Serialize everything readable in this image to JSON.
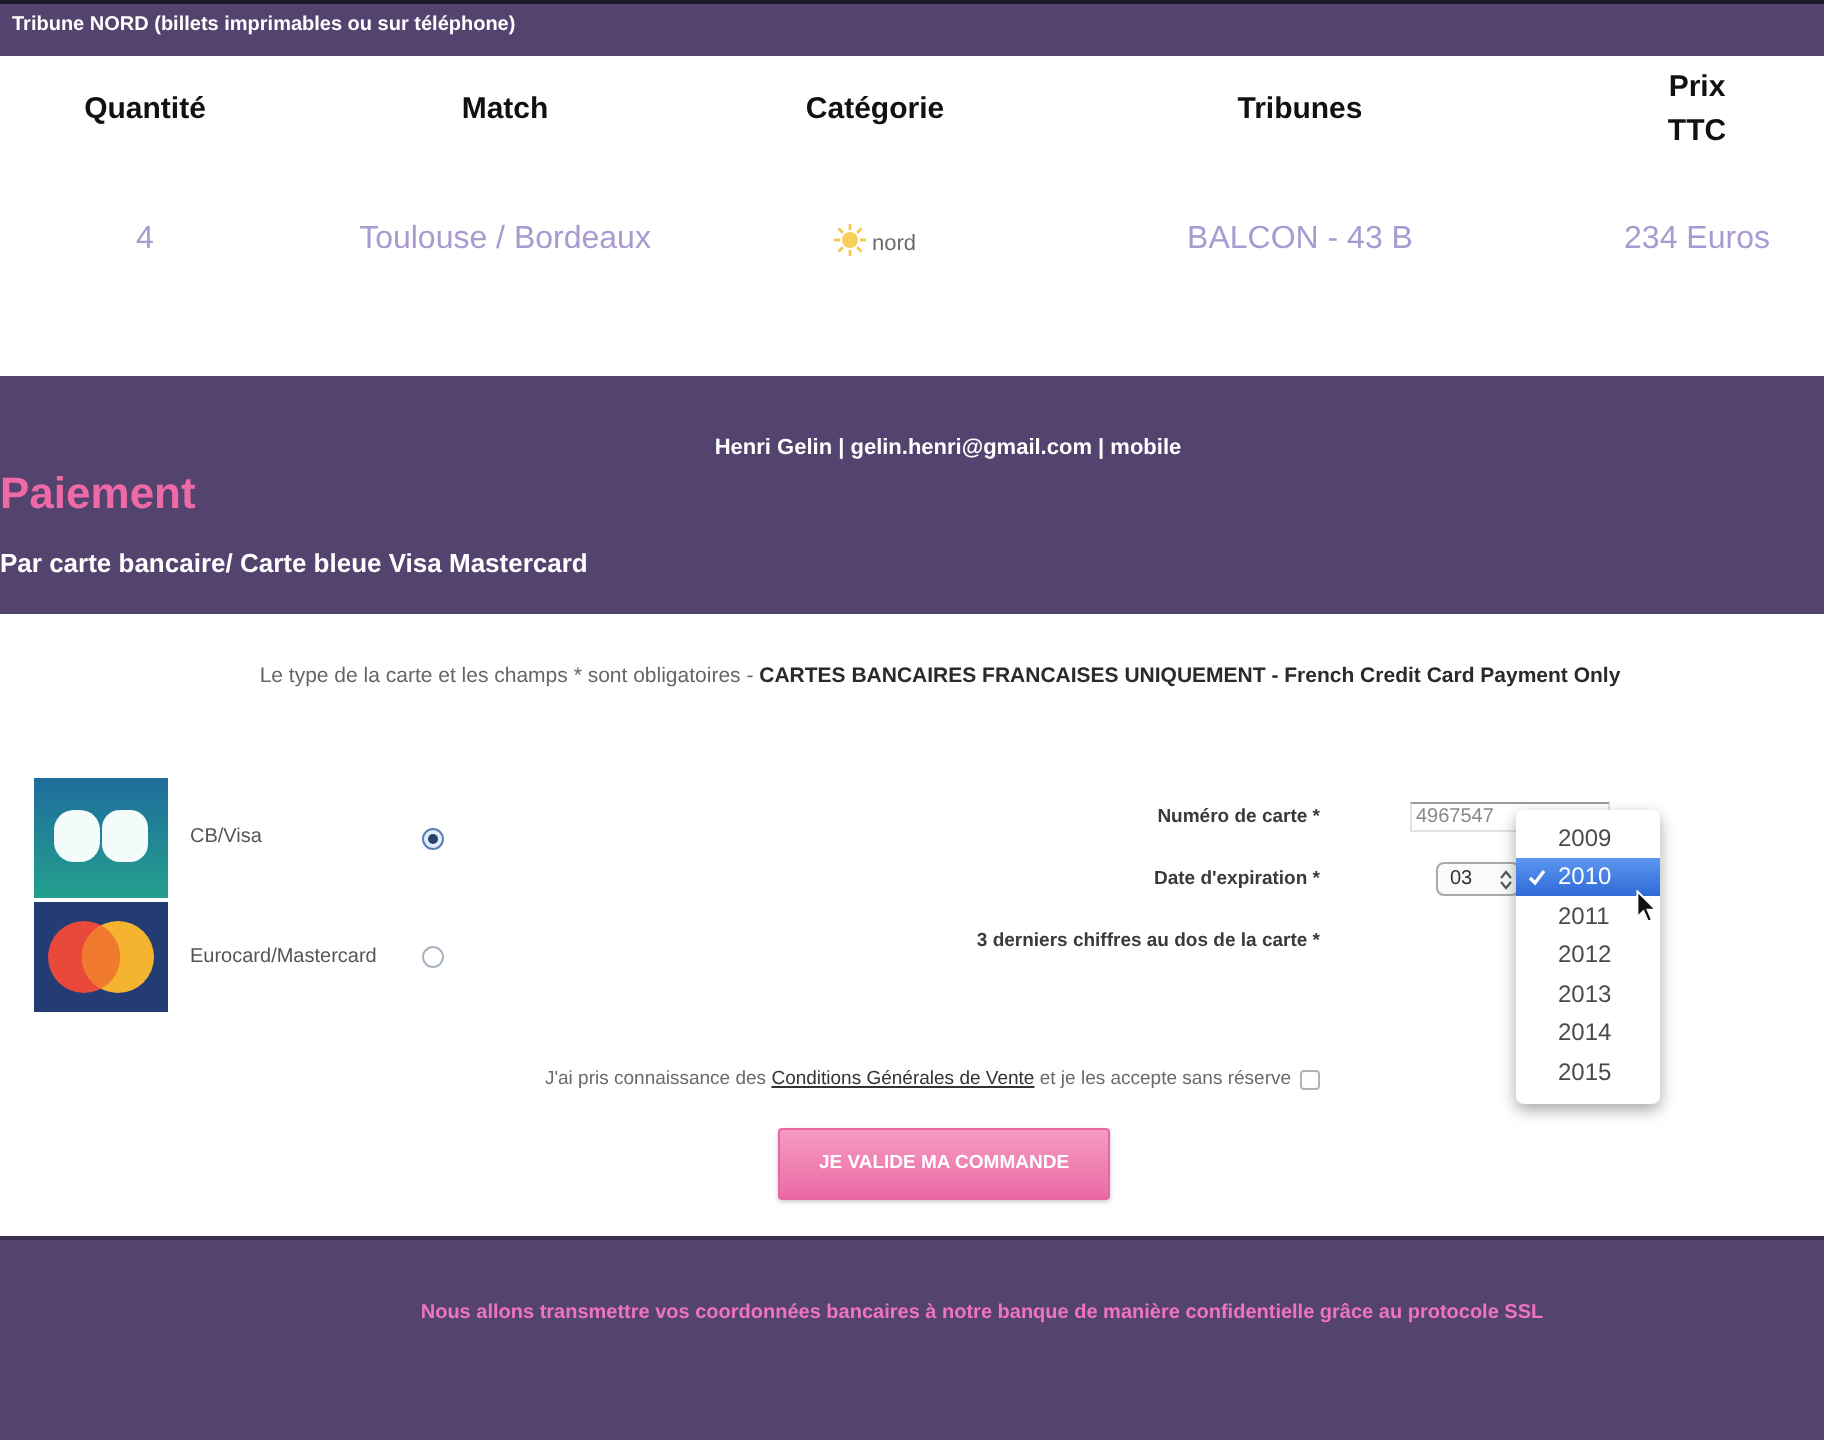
{
  "top_banner": {
    "text": "Tribune NORD (billets imprimables ou sur téléphone)"
  },
  "order_table": {
    "columns": [
      "Quantité",
      "Match",
      "Catégorie",
      "Tribunes",
      "Prix TTC"
    ],
    "rows": [
      {
        "cells": [
          {
            "kind": "text",
            "text": "4"
          },
          {
            "kind": "text",
            "text": "Toulouse / Bordeaux"
          },
          {
            "kind": "logo",
            "text": "nord"
          },
          {
            "kind": "text",
            "text": "BALCON - 43 B"
          },
          {
            "kind": "text",
            "text": "234 Euros"
          }
        ]
      }
    ]
  },
  "payment_header": {
    "customer": "Henri Gelin | gelin.henri@gmail.com | mobile",
    "title": "Paiement",
    "subtitle": "Par carte bancaire/ Carte bleue Visa Mastercard"
  },
  "payment_form": {
    "notice": "Le type de la carte et les champs * sont obligatoires - **CARTES BANCAIRES FRANCAISES UNIQUEMENT - French Credit Card Payment Only**",
    "card_types": [
      {
        "kind": "cb",
        "label": "CB/Visa",
        "selected": true
      },
      {
        "kind": "mastercard",
        "label": "Eurocard/Mastercard",
        "selected": false
      }
    ],
    "card_number": {
      "label": "Numéro de carte *",
      "value": "4967547"
    },
    "expiry": {
      "label": "Date d'expiration *",
      "month": "03"
    },
    "security_code": {
      "label": "3 derniers chiffres au dos de la carte *"
    },
    "year_dropdown": {
      "options": [
        {
          "label": "2009",
          "selected": false
        },
        {
          "label": "2010",
          "selected": true
        },
        {
          "label": "2011",
          "selected": false
        },
        {
          "label": "2012",
          "selected": false
        },
        {
          "label": "2013",
          "selected": false
        },
        {
          "label": "2014",
          "selected": false
        },
        {
          "label": "2015",
          "selected": false
        }
      ]
    },
    "terms": {
      "text_before": "J'ai pris connaissance des ",
      "link": "Conditions Générales de Vente",
      "text_after": " et je les accepte sans réserve",
      "checked": false
    },
    "submit_button": "JE VALIDE MA COMMANDE"
  },
  "footer": {
    "note": "Nous allons transmettre vos coordonnées bancaires à notre banque de manière confidentielle grâce au protocole SSL"
  }
}
